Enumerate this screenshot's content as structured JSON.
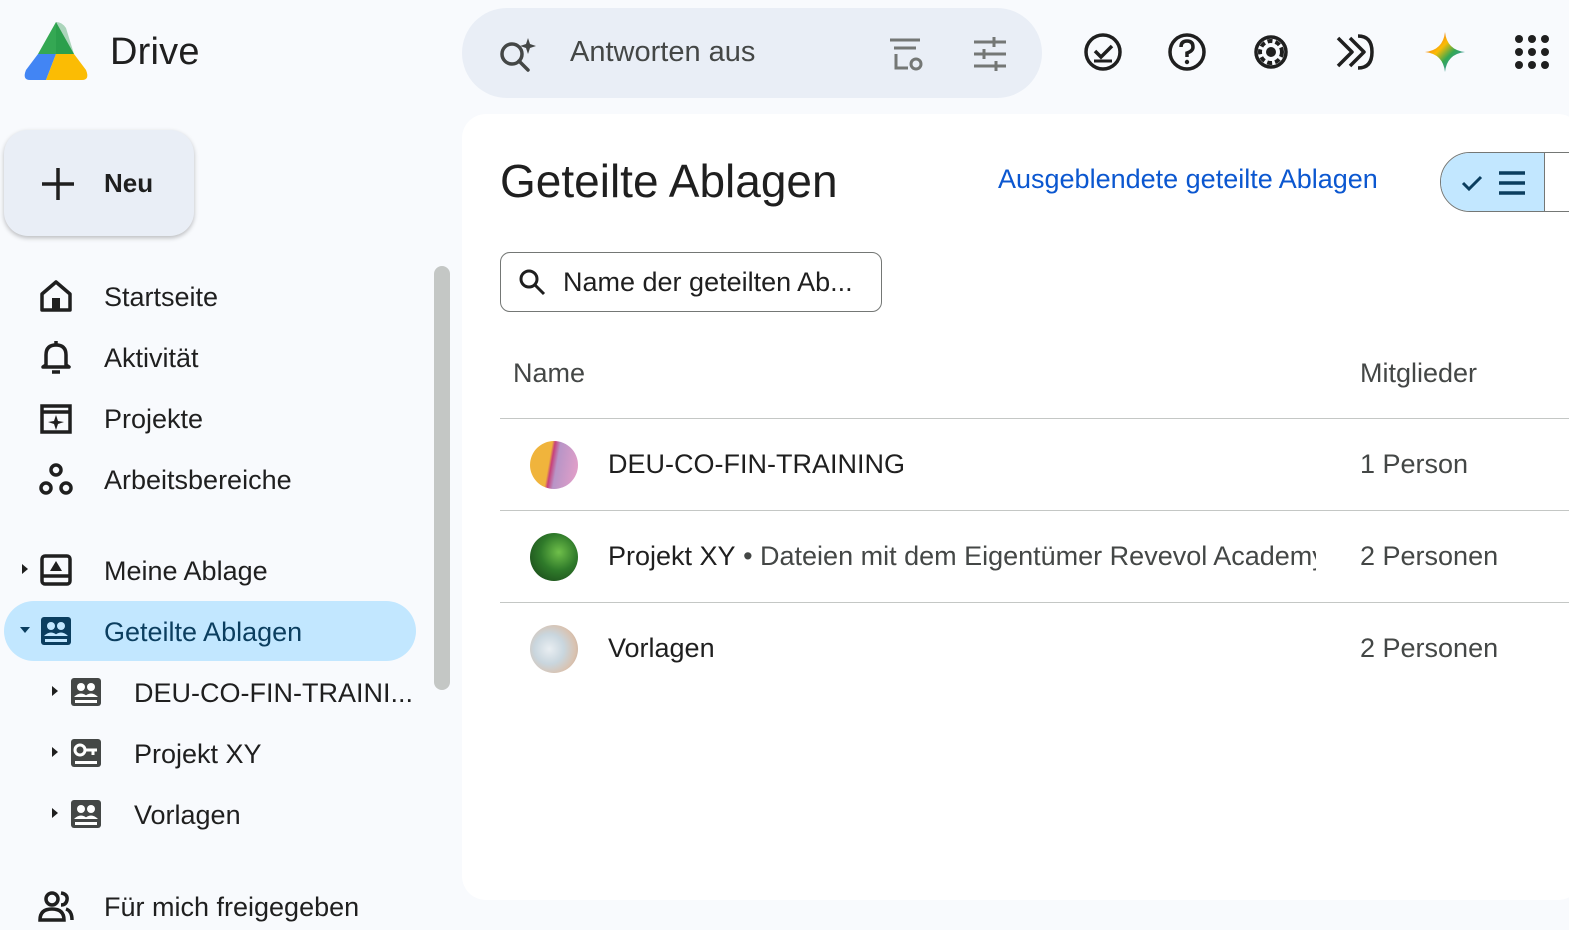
{
  "app": {
    "name": "Drive"
  },
  "search": {
    "placeholder": "Antworten aus"
  },
  "header_icons": [
    "offline-ready-icon",
    "help-icon",
    "settings-icon",
    "ai-assistant-icon",
    "gemini-icon",
    "apps-grid-icon"
  ],
  "sidebar": {
    "new_label": "Neu",
    "items": [
      {
        "label": "Startseite",
        "icon": "home-icon"
      },
      {
        "label": "Aktivität",
        "icon": "bell-icon"
      },
      {
        "label": "Projekte",
        "icon": "projects-icon"
      },
      {
        "label": "Arbeitsbereiche",
        "icon": "workspaces-icon"
      },
      {
        "label": "Meine Ablage",
        "icon": "my-drive-icon"
      },
      {
        "label": "Geteilte Ablagen",
        "icon": "shared-drives-icon",
        "active": true
      },
      {
        "label": "DEU-CO-FIN-TRAINI...",
        "icon": "shared-drive-icon"
      },
      {
        "label": "Projekt XY",
        "icon": "restricted-drive-icon"
      },
      {
        "label": "Vorlagen",
        "icon": "shared-drive-icon"
      },
      {
        "label": "Für mich freigegeben",
        "icon": "people-icon"
      }
    ]
  },
  "main": {
    "title": "Geteilte Ablagen",
    "hidden_link": "Ausgeblendete geteilte Ablagen",
    "filter_placeholder": "Name der geteilten Ab...",
    "columns": {
      "name": "Name",
      "members": "Mitglieder"
    },
    "rows": [
      {
        "name": "DEU-CO-FIN-TRAINING",
        "description": "",
        "members": "1 Person"
      },
      {
        "name": "Projekt XY",
        "description": " • Dateien mit dem Eigentümer Revevol Academy",
        "members": "2 Personen"
      },
      {
        "name": "Vorlagen",
        "description": "",
        "members": "2 Personen"
      }
    ]
  },
  "colors": {
    "accent": "#0b57d0",
    "active_bg": "#c2e7ff",
    "search_bg": "#e9eef6"
  }
}
